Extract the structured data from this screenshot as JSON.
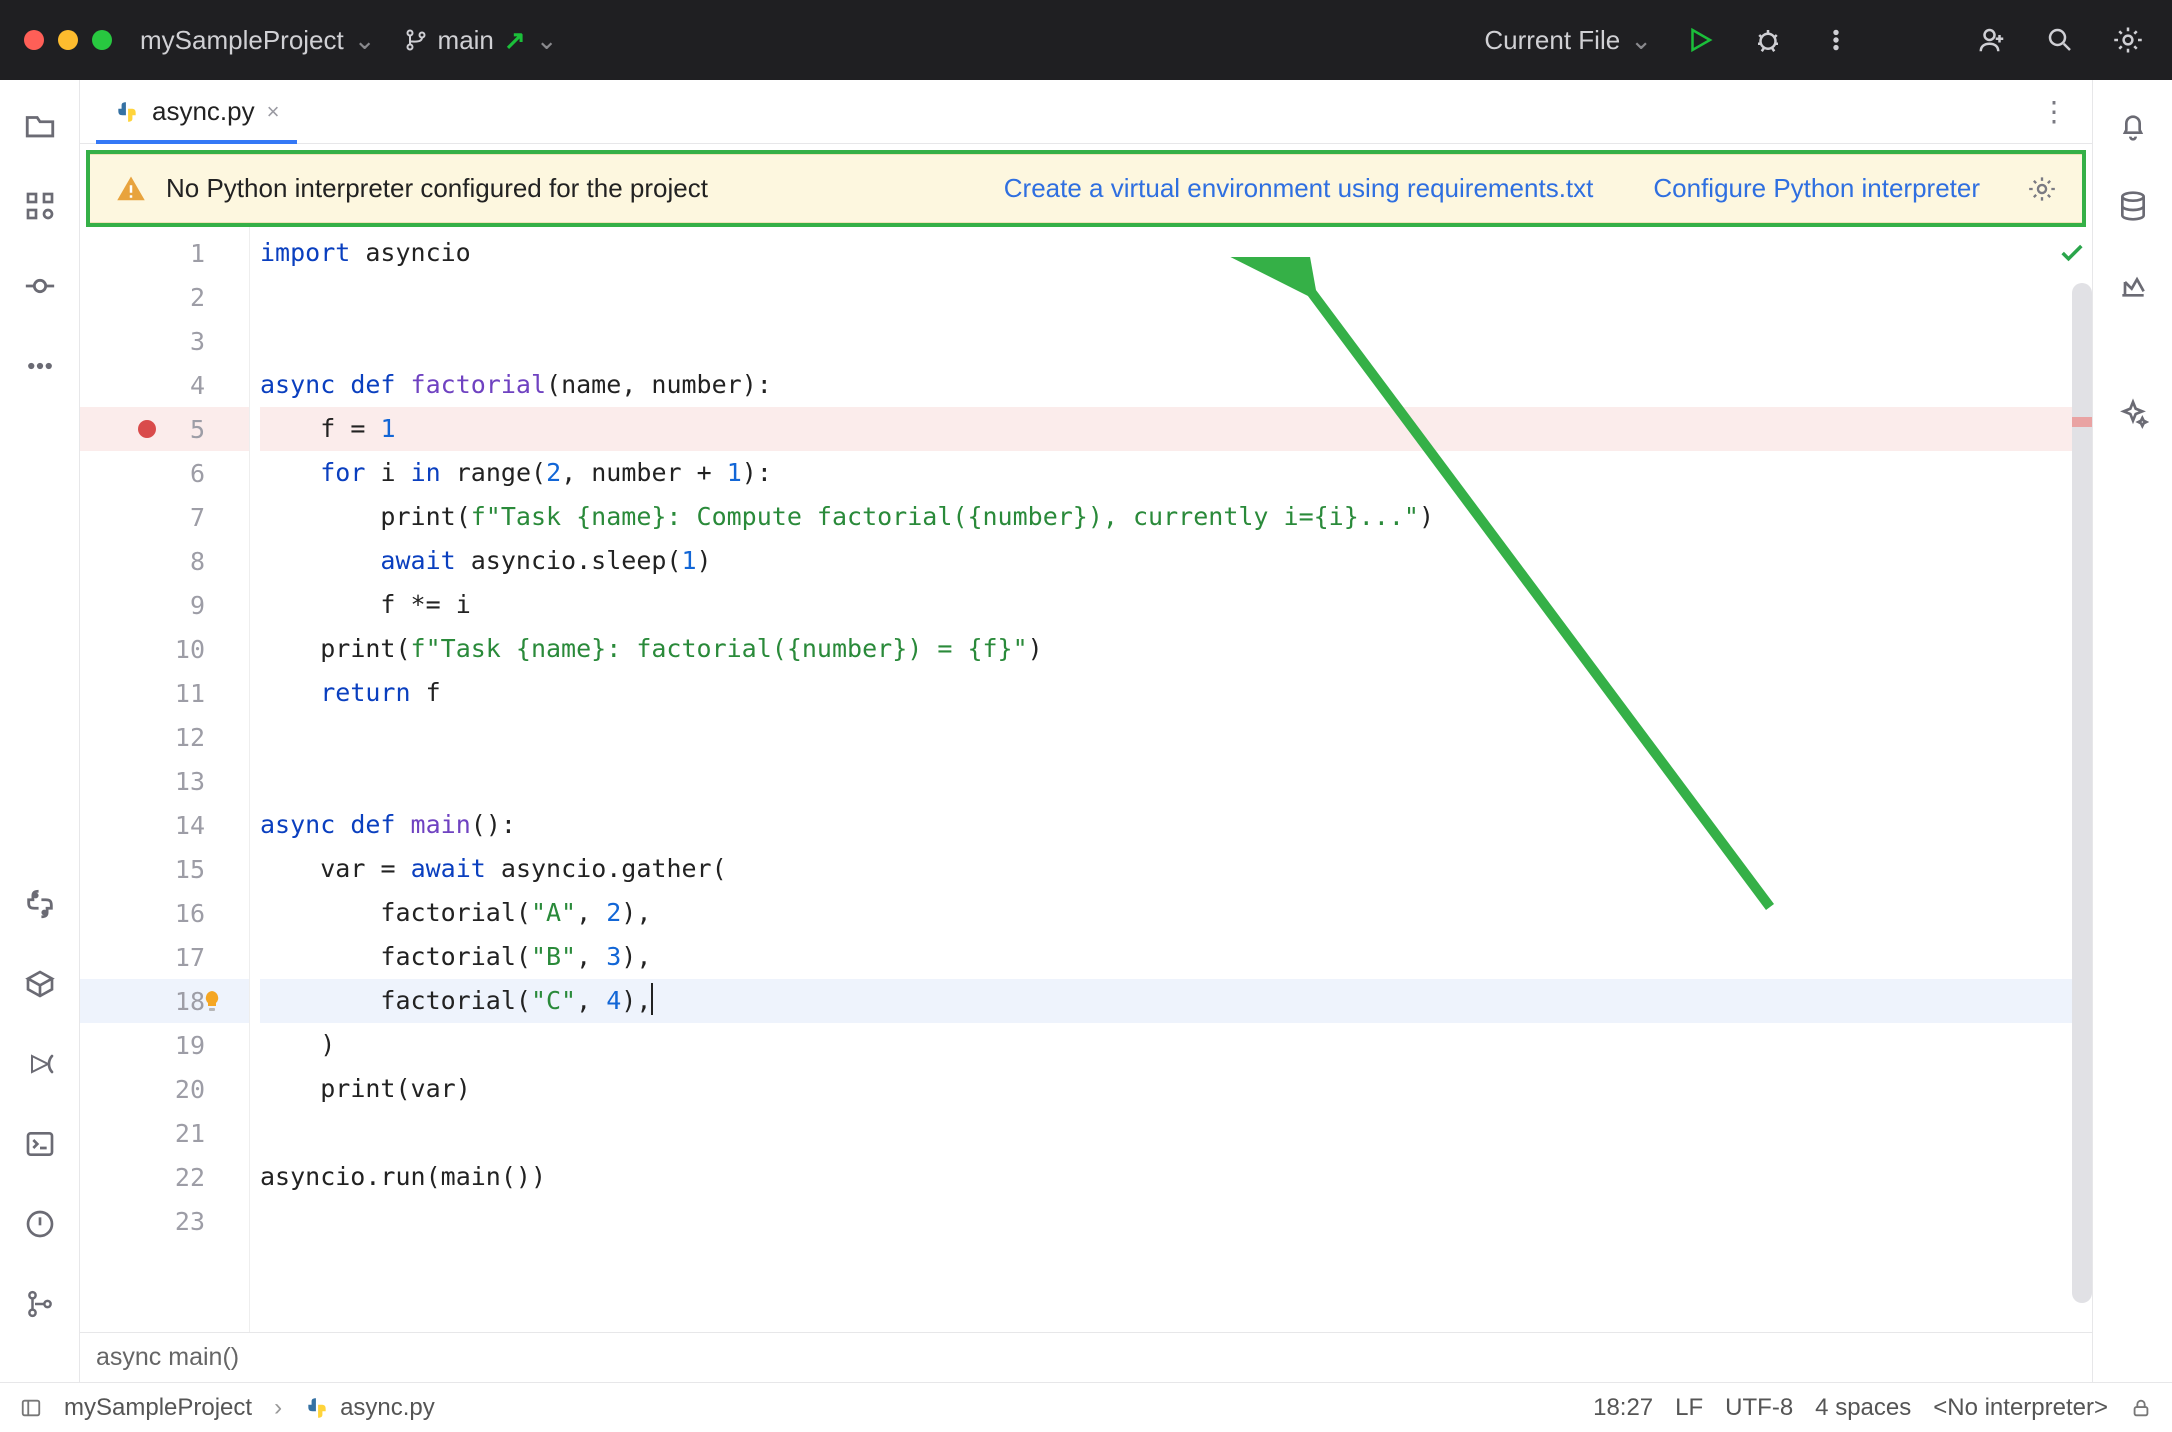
{
  "titlebar": {
    "project": "mySampleProject",
    "branch": "main",
    "run_config": "Current File"
  },
  "tab": {
    "filename": "async.py"
  },
  "banner": {
    "message": "No Python interpreter configured for the project",
    "link1": "Create a virtual environment using requirements.txt",
    "link2": "Configure Python interpreter"
  },
  "code": {
    "lines": [
      {
        "n": 1,
        "tokens": [
          [
            "kw",
            "import"
          ],
          [
            "sp",
            " "
          ],
          [
            "id",
            "asyncio"
          ]
        ]
      },
      {
        "n": 2,
        "tokens": []
      },
      {
        "n": 3,
        "tokens": []
      },
      {
        "n": 4,
        "tokens": [
          [
            "kw",
            "async"
          ],
          [
            "sp",
            " "
          ],
          [
            "kw",
            "def"
          ],
          [
            "sp",
            " "
          ],
          [
            "fn",
            "factorial"
          ],
          [
            "op",
            "("
          ],
          [
            "id",
            "name"
          ],
          [
            "op",
            ", "
          ],
          [
            "id",
            "number"
          ],
          [
            "op",
            ")"
          ],
          [
            "op",
            ":"
          ]
        ]
      },
      {
        "n": 5,
        "bp": true,
        "tokens": [
          [
            "sp",
            "    "
          ],
          [
            "id",
            "f"
          ],
          [
            "sp",
            " "
          ],
          [
            "op",
            "="
          ],
          [
            "sp",
            " "
          ],
          [
            "num",
            "1"
          ]
        ]
      },
      {
        "n": 6,
        "tokens": [
          [
            "sp",
            "    "
          ],
          [
            "kw",
            "for"
          ],
          [
            "sp",
            " "
          ],
          [
            "id",
            "i"
          ],
          [
            "sp",
            " "
          ],
          [
            "kw",
            "in"
          ],
          [
            "sp",
            " "
          ],
          [
            "id",
            "range"
          ],
          [
            "op",
            "("
          ],
          [
            "num",
            "2"
          ],
          [
            "op",
            ", "
          ],
          [
            "id",
            "number"
          ],
          [
            "sp",
            " "
          ],
          [
            "op",
            "+"
          ],
          [
            "sp",
            " "
          ],
          [
            "num",
            "1"
          ],
          [
            "op",
            ")"
          ],
          [
            "op",
            ":"
          ]
        ]
      },
      {
        "n": 7,
        "tokens": [
          [
            "sp",
            "        "
          ],
          [
            "id",
            "print"
          ],
          [
            "op",
            "("
          ],
          [
            "str",
            "f\"Task {name}: Compute factorial({number}), currently i={i}...\""
          ],
          [
            "op",
            ")"
          ]
        ]
      },
      {
        "n": 8,
        "tokens": [
          [
            "sp",
            "        "
          ],
          [
            "kw",
            "await"
          ],
          [
            "sp",
            " "
          ],
          [
            "id",
            "asyncio.sleep"
          ],
          [
            "op",
            "("
          ],
          [
            "num",
            "1"
          ],
          [
            "op",
            ")"
          ]
        ]
      },
      {
        "n": 9,
        "tokens": [
          [
            "sp",
            "        "
          ],
          [
            "id",
            "f"
          ],
          [
            "sp",
            " "
          ],
          [
            "op",
            "*="
          ],
          [
            "sp",
            " "
          ],
          [
            "id",
            "i"
          ]
        ]
      },
      {
        "n": 10,
        "tokens": [
          [
            "sp",
            "    "
          ],
          [
            "id",
            "print"
          ],
          [
            "op",
            "("
          ],
          [
            "str",
            "f\"Task {name}: factorial({number}) = {f}\""
          ],
          [
            "op",
            ")"
          ]
        ]
      },
      {
        "n": 11,
        "tokens": [
          [
            "sp",
            "    "
          ],
          [
            "kw",
            "return"
          ],
          [
            "sp",
            " "
          ],
          [
            "id",
            "f"
          ]
        ]
      },
      {
        "n": 12,
        "tokens": []
      },
      {
        "n": 13,
        "tokens": []
      },
      {
        "n": 14,
        "tokens": [
          [
            "kw",
            "async"
          ],
          [
            "sp",
            " "
          ],
          [
            "kw",
            "def"
          ],
          [
            "sp",
            " "
          ],
          [
            "fn",
            "main"
          ],
          [
            "op",
            "()"
          ],
          [
            "op",
            ":"
          ]
        ]
      },
      {
        "n": 15,
        "tokens": [
          [
            "sp",
            "    "
          ],
          [
            "id",
            "var"
          ],
          [
            "sp",
            " "
          ],
          [
            "op",
            "="
          ],
          [
            "sp",
            " "
          ],
          [
            "kw",
            "await"
          ],
          [
            "sp",
            " "
          ],
          [
            "id",
            "asyncio.gather"
          ],
          [
            "op",
            "("
          ]
        ]
      },
      {
        "n": 16,
        "tokens": [
          [
            "sp",
            "        "
          ],
          [
            "id",
            "factorial"
          ],
          [
            "op",
            "("
          ],
          [
            "str",
            "\"A\""
          ],
          [
            "op",
            ", "
          ],
          [
            "num",
            "2"
          ],
          [
            "op",
            ")"
          ],
          [
            "op",
            ","
          ]
        ]
      },
      {
        "n": 17,
        "tokens": [
          [
            "sp",
            "        "
          ],
          [
            "id",
            "factorial"
          ],
          [
            "op",
            "("
          ],
          [
            "str",
            "\"B\""
          ],
          [
            "op",
            ", "
          ],
          [
            "num",
            "3"
          ],
          [
            "op",
            ")"
          ],
          [
            "op",
            ","
          ]
        ]
      },
      {
        "n": 18,
        "cursor": true,
        "bulb": true,
        "tokens": [
          [
            "sp",
            "        "
          ],
          [
            "id",
            "factorial"
          ],
          [
            "op",
            "("
          ],
          [
            "str",
            "\"C\""
          ],
          [
            "op",
            ", "
          ],
          [
            "num",
            "4"
          ],
          [
            "op",
            ")"
          ],
          [
            "op",
            ","
          ]
        ]
      },
      {
        "n": 19,
        "tokens": [
          [
            "sp",
            "    "
          ],
          [
            "op",
            ")"
          ]
        ]
      },
      {
        "n": 20,
        "tokens": [
          [
            "sp",
            "    "
          ],
          [
            "id",
            "print"
          ],
          [
            "op",
            "("
          ],
          [
            "id",
            "var"
          ],
          [
            "op",
            ")"
          ]
        ]
      },
      {
        "n": 21,
        "tokens": []
      },
      {
        "n": 22,
        "tokens": [
          [
            "id",
            "asyncio.run"
          ],
          [
            "op",
            "("
          ],
          [
            "id",
            "main"
          ],
          [
            "op",
            "()"
          ],
          [
            "op",
            ")"
          ]
        ]
      },
      {
        "n": 23,
        "tokens": []
      }
    ]
  },
  "crumb": "async main()",
  "status": {
    "project": "mySampleProject",
    "file": "async.py",
    "pos": "18:27",
    "eol": "LF",
    "enc": "UTF-8",
    "indent": "4 spaces",
    "interp": "<No interpreter>"
  }
}
